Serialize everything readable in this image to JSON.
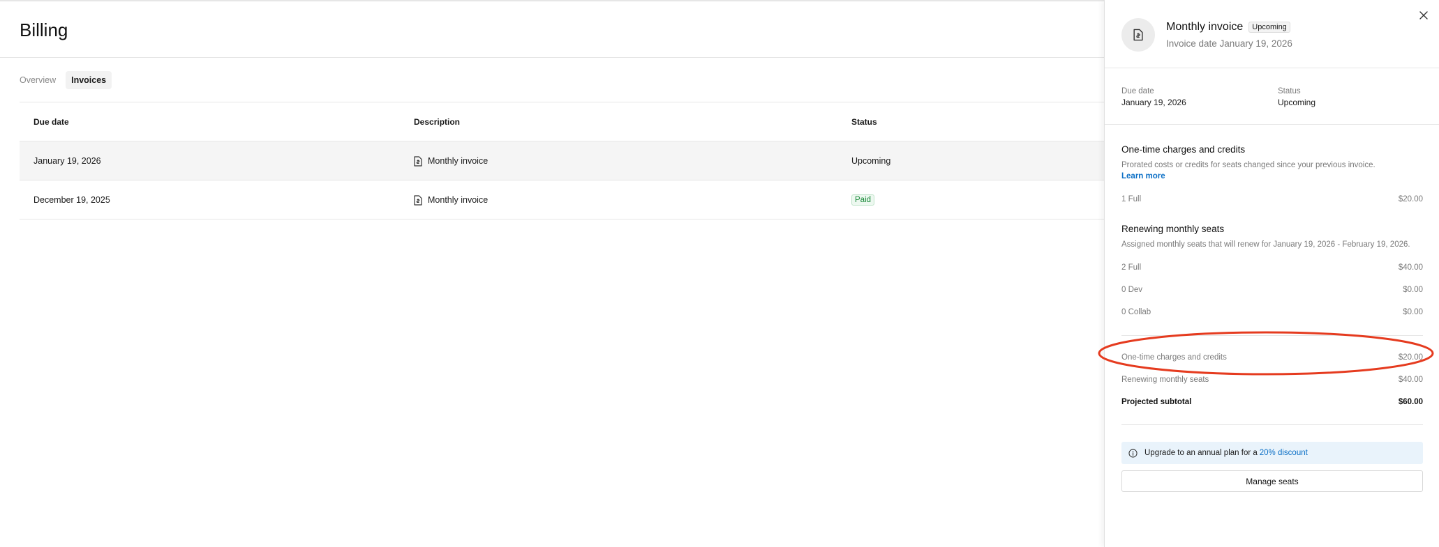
{
  "page": {
    "title": "Billing"
  },
  "tabs": [
    {
      "label": "Overview",
      "active": false
    },
    {
      "label": "Invoices",
      "active": true
    }
  ],
  "table": {
    "headers": [
      "Due date",
      "Description",
      "Status"
    ],
    "rows": [
      {
        "due_date": "January 19, 2026",
        "description": "Monthly invoice",
        "status": "Upcoming"
      },
      {
        "due_date": "December 19, 2025",
        "description": "Monthly invoice",
        "status": "Paid"
      }
    ]
  },
  "panel": {
    "title": "Monthly invoice",
    "status_badge": "Upcoming",
    "invoice_date": "Invoice date January 19, 2026",
    "due_date_label": "Due date",
    "due_date_value": "January 19, 2026",
    "status_label": "Status",
    "status_value": "Upcoming",
    "one_time": {
      "title": "One-time charges and credits",
      "description": "Prorated costs or credits for seats changed since your previous invoice.",
      "link": "Learn more",
      "lines": [
        {
          "label": "1 Full",
          "amount": "$20.00"
        }
      ]
    },
    "renewing": {
      "title": "Renewing monthly seats",
      "description": "Assigned monthly seats that will renew for January 19, 2026 - February 19, 2026.",
      "lines": [
        {
          "label": "2 Full",
          "amount": "$40.00"
        },
        {
          "label": "0 Dev",
          "amount": "$0.00"
        },
        {
          "label": "0 Collab",
          "amount": "$0.00"
        }
      ]
    },
    "summary": [
      {
        "label": "One-time charges and credits",
        "amount": "$20.00"
      },
      {
        "label": "Renewing monthly seats",
        "amount": "$40.00"
      }
    ],
    "subtotal": {
      "label": "Projected subtotal",
      "amount": "$60.00"
    },
    "upgrade": {
      "text": "Upgrade to an annual plan for a",
      "link": "20% discount"
    },
    "manage_button": "Manage seats"
  },
  "colors": {
    "link": "#0b6fc6",
    "paid": "#1b8a3a",
    "highlight": "#e53b1f",
    "info_bg": "#e9f3fb"
  }
}
